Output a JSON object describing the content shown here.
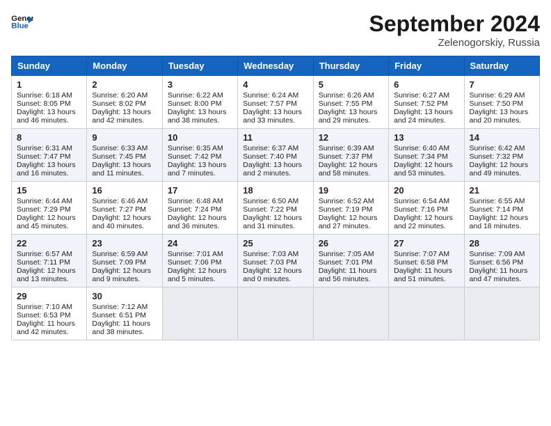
{
  "header": {
    "logo_line1": "General",
    "logo_line2": "Blue",
    "month": "September 2024",
    "location": "Zelenogorskiy, Russia"
  },
  "days_of_week": [
    "Sunday",
    "Monday",
    "Tuesday",
    "Wednesday",
    "Thursday",
    "Friday",
    "Saturday"
  ],
  "weeks": [
    [
      {
        "day": "1",
        "info": "Sunrise: 6:18 AM\nSunset: 8:05 PM\nDaylight: 13 hours and 46 minutes."
      },
      {
        "day": "2",
        "info": "Sunrise: 6:20 AM\nSunset: 8:02 PM\nDaylight: 13 hours and 42 minutes."
      },
      {
        "day": "3",
        "info": "Sunrise: 6:22 AM\nSunset: 8:00 PM\nDaylight: 13 hours and 38 minutes."
      },
      {
        "day": "4",
        "info": "Sunrise: 6:24 AM\nSunset: 7:57 PM\nDaylight: 13 hours and 33 minutes."
      },
      {
        "day": "5",
        "info": "Sunrise: 6:26 AM\nSunset: 7:55 PM\nDaylight: 13 hours and 29 minutes."
      },
      {
        "day": "6",
        "info": "Sunrise: 6:27 AM\nSunset: 7:52 PM\nDaylight: 13 hours and 24 minutes."
      },
      {
        "day": "7",
        "info": "Sunrise: 6:29 AM\nSunset: 7:50 PM\nDaylight: 13 hours and 20 minutes."
      }
    ],
    [
      {
        "day": "8",
        "info": "Sunrise: 6:31 AM\nSunset: 7:47 PM\nDaylight: 13 hours and 16 minutes."
      },
      {
        "day": "9",
        "info": "Sunrise: 6:33 AM\nSunset: 7:45 PM\nDaylight: 13 hours and 11 minutes."
      },
      {
        "day": "10",
        "info": "Sunrise: 6:35 AM\nSunset: 7:42 PM\nDaylight: 13 hours and 7 minutes."
      },
      {
        "day": "11",
        "info": "Sunrise: 6:37 AM\nSunset: 7:40 PM\nDaylight: 13 hours and 2 minutes."
      },
      {
        "day": "12",
        "info": "Sunrise: 6:39 AM\nSunset: 7:37 PM\nDaylight: 12 hours and 58 minutes."
      },
      {
        "day": "13",
        "info": "Sunrise: 6:40 AM\nSunset: 7:34 PM\nDaylight: 12 hours and 53 minutes."
      },
      {
        "day": "14",
        "info": "Sunrise: 6:42 AM\nSunset: 7:32 PM\nDaylight: 12 hours and 49 minutes."
      }
    ],
    [
      {
        "day": "15",
        "info": "Sunrise: 6:44 AM\nSunset: 7:29 PM\nDaylight: 12 hours and 45 minutes."
      },
      {
        "day": "16",
        "info": "Sunrise: 6:46 AM\nSunset: 7:27 PM\nDaylight: 12 hours and 40 minutes."
      },
      {
        "day": "17",
        "info": "Sunrise: 6:48 AM\nSunset: 7:24 PM\nDaylight: 12 hours and 36 minutes."
      },
      {
        "day": "18",
        "info": "Sunrise: 6:50 AM\nSunset: 7:22 PM\nDaylight: 12 hours and 31 minutes."
      },
      {
        "day": "19",
        "info": "Sunrise: 6:52 AM\nSunset: 7:19 PM\nDaylight: 12 hours and 27 minutes."
      },
      {
        "day": "20",
        "info": "Sunrise: 6:54 AM\nSunset: 7:16 PM\nDaylight: 12 hours and 22 minutes."
      },
      {
        "day": "21",
        "info": "Sunrise: 6:55 AM\nSunset: 7:14 PM\nDaylight: 12 hours and 18 minutes."
      }
    ],
    [
      {
        "day": "22",
        "info": "Sunrise: 6:57 AM\nSunset: 7:11 PM\nDaylight: 12 hours and 13 minutes."
      },
      {
        "day": "23",
        "info": "Sunrise: 6:59 AM\nSunset: 7:09 PM\nDaylight: 12 hours and 9 minutes."
      },
      {
        "day": "24",
        "info": "Sunrise: 7:01 AM\nSunset: 7:06 PM\nDaylight: 12 hours and 5 minutes."
      },
      {
        "day": "25",
        "info": "Sunrise: 7:03 AM\nSunset: 7:03 PM\nDaylight: 12 hours and 0 minutes."
      },
      {
        "day": "26",
        "info": "Sunrise: 7:05 AM\nSunset: 7:01 PM\nDaylight: 11 hours and 56 minutes."
      },
      {
        "day": "27",
        "info": "Sunrise: 7:07 AM\nSunset: 6:58 PM\nDaylight: 11 hours and 51 minutes."
      },
      {
        "day": "28",
        "info": "Sunrise: 7:09 AM\nSunset: 6:56 PM\nDaylight: 11 hours and 47 minutes."
      }
    ],
    [
      {
        "day": "29",
        "info": "Sunrise: 7:10 AM\nSunset: 6:53 PM\nDaylight: 11 hours and 42 minutes."
      },
      {
        "day": "30",
        "info": "Sunrise: 7:12 AM\nSunset: 6:51 PM\nDaylight: 11 hours and 38 minutes."
      },
      null,
      null,
      null,
      null,
      null
    ]
  ]
}
